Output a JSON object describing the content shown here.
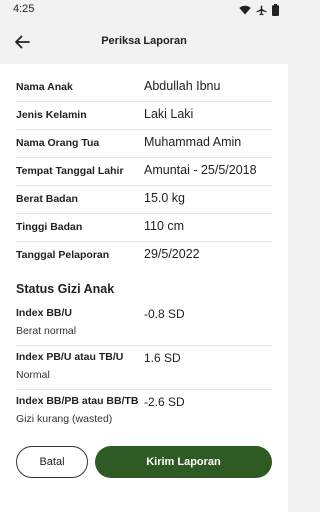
{
  "status_bar": {
    "time": "4:25",
    "icons": [
      "wifi-icon",
      "airplane-icon",
      "battery-icon"
    ]
  },
  "app_bar": {
    "title": "Periksa Laporan",
    "back_icon": "arrow-left-icon"
  },
  "child_details": [
    {
      "label": "Nama Anak",
      "value": "Abdullah Ibnu"
    },
    {
      "label": "Jenis Kelamin",
      "value": "Laki Laki"
    },
    {
      "label": "Nama Orang Tua",
      "value": "Muhammad Amin"
    },
    {
      "label": "Tempat Tanggal Lahir",
      "value": "Amuntai - 25/5/2018"
    },
    {
      "label": "Berat Badan",
      "value": "15.0 kg"
    },
    {
      "label": "Tinggi Badan",
      "value": "110 cm"
    },
    {
      "label": "Tanggal Pelaporan",
      "value": "29/5/2022"
    }
  ],
  "nutrition": {
    "title": "Status Gizi Anak",
    "items": [
      {
        "label": "Index BB/U",
        "value": "-0.8 SD",
        "status": "Berat normal"
      },
      {
        "label": "Index PB/U atau TB/U",
        "value": "1.6 SD",
        "status": "Normal"
      },
      {
        "label": "Index BB/PB atau BB/TB",
        "value": "-2.6 SD",
        "status": "Gizi kurang (wasted)"
      }
    ]
  },
  "actions": {
    "cancel_label": "Batal",
    "submit_label": "Kirim Laporan"
  },
  "colors": {
    "primary": "#2e5a24",
    "background": "#f2f2f2",
    "surface": "#ffffff"
  }
}
